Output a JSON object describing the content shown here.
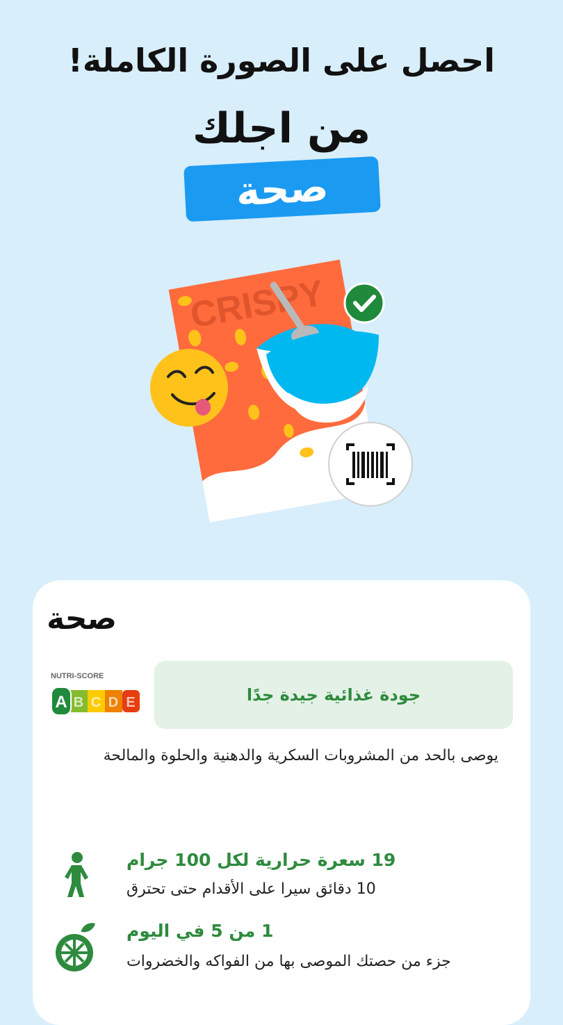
{
  "header": {
    "title": "احصل على الصورة الكاملة!",
    "subtitle": "من اجلك",
    "tag": "صحة"
  },
  "illustration": {
    "package_text": "CRISPY",
    "icons": [
      "smiling-emoji-icon",
      "check-icon",
      "barcode-scan-icon"
    ]
  },
  "card": {
    "title": "صحة",
    "nutri_score": {
      "label": "NUTRI-SCORE",
      "grades": [
        "A",
        "B",
        "C",
        "D",
        "E"
      ],
      "active": "A"
    },
    "quality": "جودة غذائية جيدة جدًا",
    "advice": "يوصى بالحد من المشروبات السكرية والدهنية والحلوة والمالحة",
    "rows": [
      {
        "icon": "walking-person-icon",
        "title": "19 سعرة حرارية لكل 100 جرام",
        "desc": "10 دقائق سيرا على الأقدام حتى تحترق"
      },
      {
        "icon": "fruit-icon",
        "title": "1 من 5 في اليوم",
        "desc": "جزء من حصتك الموصى بها من الفواكه والخضروات"
      }
    ]
  },
  "colors": {
    "background": "#d8eefb",
    "accent_blue": "#1b9af1",
    "green": "#2e8b3e",
    "package_orange": "#ff6b3d",
    "bowl_blue": "#00b8f0"
  }
}
